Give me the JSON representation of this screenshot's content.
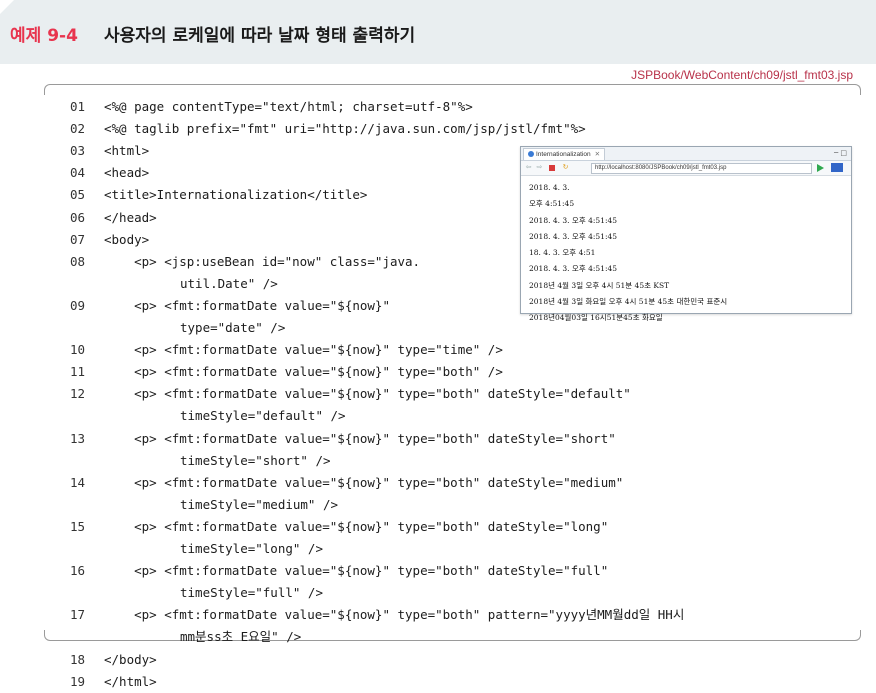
{
  "header": {
    "label": "예제 9-4",
    "title": "사용자의 로케일에 따라 날짜 형태 출력하기"
  },
  "file_path": "JSPBook/WebContent/ch09/jstl_fmt03.jsp",
  "code_lines": [
    {
      "num": "01",
      "text": "<%@ page contentType=\"text/html; charset=utf-8\"%>"
    },
    {
      "num": "02",
      "text": "<%@ taglib prefix=\"fmt\" uri=\"http://java.sun.com/jsp/jstl/fmt\"%>"
    },
    {
      "num": "03",
      "text": "<html>"
    },
    {
      "num": "04",
      "text": "<head>"
    },
    {
      "num": "05",
      "text": "<title>Internationalization</title>"
    },
    {
      "num": "06",
      "text": "</head>"
    },
    {
      "num": "07",
      "text": "<body>"
    },
    {
      "num": "08",
      "text": "    <p> <jsp:useBean id=\"now\" class=\"java."
    },
    {
      "num": "",
      "text": "util.Date\" />"
    },
    {
      "num": "09",
      "text": "    <p> <fmt:formatDate value=\"${now}\""
    },
    {
      "num": "",
      "text": "type=\"date\" />"
    },
    {
      "num": "10",
      "text": "    <p> <fmt:formatDate value=\"${now}\" type=\"time\" />"
    },
    {
      "num": "11",
      "text": "    <p> <fmt:formatDate value=\"${now}\" type=\"both\" />"
    },
    {
      "num": "12",
      "text": "    <p> <fmt:formatDate value=\"${now}\" type=\"both\" dateStyle=\"default\""
    },
    {
      "num": "",
      "text": "timeStyle=\"default\" />"
    },
    {
      "num": "13",
      "text": "    <p> <fmt:formatDate value=\"${now}\" type=\"both\" dateStyle=\"short\""
    },
    {
      "num": "",
      "text": "timeStyle=\"short\" />"
    },
    {
      "num": "14",
      "text": "    <p> <fmt:formatDate value=\"${now}\" type=\"both\" dateStyle=\"medium\""
    },
    {
      "num": "",
      "text": "timeStyle=\"medium\" />"
    },
    {
      "num": "15",
      "text": "    <p> <fmt:formatDate value=\"${now}\" type=\"both\" dateStyle=\"long\""
    },
    {
      "num": "",
      "text": "timeStyle=\"long\" />"
    },
    {
      "num": "16",
      "text": "    <p> <fmt:formatDate value=\"${now}\" type=\"both\" dateStyle=\"full\""
    },
    {
      "num": "",
      "text": "timeStyle=\"full\" />"
    },
    {
      "num": "17",
      "text": "    <p> <fmt:formatDate value=\"${now}\" type=\"both\" pattern=\"yyyy년MM월dd일 HH시"
    },
    {
      "num": "",
      "text": "mm분ss초 E요일\" />"
    },
    {
      "num": "18",
      "text": "</body>"
    },
    {
      "num": "19",
      "text": "</html>"
    }
  ],
  "browser": {
    "tab_title": "Internationalization",
    "tab_close": "✕",
    "window_controls": "─ □",
    "url": "http://localhost:8080/JSPBook/ch09/jstl_fmt03.jsp",
    "output_lines": [
      "2018. 4. 3.",
      "오후 4:51:45",
      "2018. 4. 3. 오후 4:51:45",
      "2018. 4. 3. 오후 4:51:45",
      "18. 4. 3. 오후 4:51",
      "2018. 4. 3. 오후 4:51:45",
      "2018년 4월 3일 오후 4시 51분 45초 KST",
      "2018년 4월 3일 화요일 오후 4시 51분 45초 대한민국 표준시",
      "2018년04월03일 16시51분45초 화요일"
    ]
  }
}
